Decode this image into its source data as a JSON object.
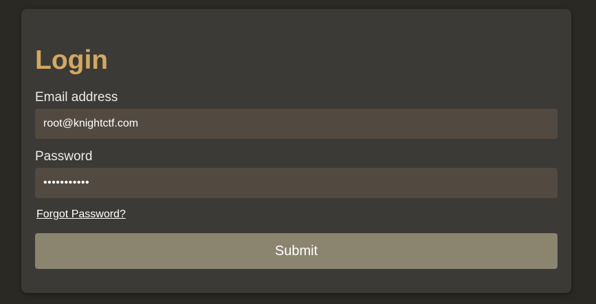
{
  "login": {
    "title": "Login",
    "email_label": "Email address",
    "email_value": "root@knightctf.com",
    "password_label": "Password",
    "password_value": "•••••••••••",
    "forgot_link": "Forgot Password?",
    "submit_label": "Submit"
  },
  "colors": {
    "background": "#2a2924",
    "card": "#3b3a36",
    "title": "#d4a862",
    "input_bg": "#524a41",
    "button_bg": "#8b8570"
  }
}
